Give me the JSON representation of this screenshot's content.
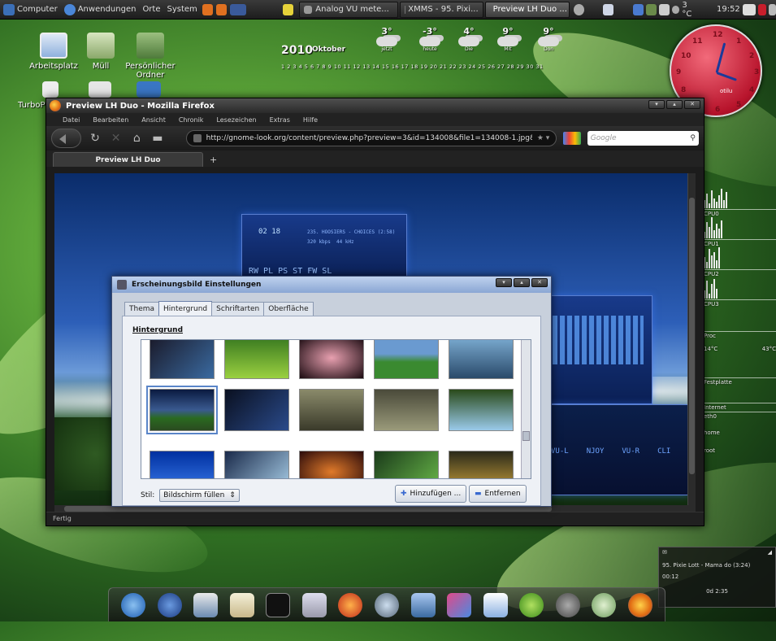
{
  "top_panel": {
    "menus": [
      "Computer",
      "Anwendungen",
      "Orte",
      "System"
    ],
    "tasks": [
      {
        "label": "Analog VU mete..."
      },
      {
        "label": "XMMS - 95. Pixi..."
      },
      {
        "label": "Preview LH Duo ..."
      }
    ],
    "weather_temp": "3 °C",
    "time": "19:52"
  },
  "desktop_icons": [
    "Arbeitsplatz",
    "Müll",
    "Persönlicher Ordner",
    "TurboP"
  ],
  "calendar": {
    "year": "2010",
    "month": "Oktober",
    "days": "1  2  3  4  5  6  7  8  9  10  11  12  13  14  15  16  17  18  19  20  21  22  23  24  25  26  27  28  29  30  31",
    "weather": [
      {
        "temp": "3°",
        "label": "jetzt"
      },
      {
        "temp": "-3°",
        "label": "heute"
      },
      {
        "temp": "4°",
        "label": "Die"
      },
      {
        "temp": "9°",
        "label": "Mit"
      },
      {
        "temp": "9°",
        "label": "Don"
      }
    ]
  },
  "clock": {
    "numbers": [
      "12",
      "1",
      "2",
      "3",
      "4",
      "5",
      "6",
      "7",
      "8",
      "9",
      "10",
      "11"
    ],
    "label": "otilu"
  },
  "firefox": {
    "title": "Preview LH Duo - Mozilla Firefox",
    "menu": [
      "Datei",
      "Bearbeiten",
      "Ansicht",
      "Chronik",
      "Lesezeichen",
      "Extras",
      "Hilfe"
    ],
    "url": "http://gnome-look.org/content/preview.php?preview=3&id=134008&file1=134008-1.jpg&f",
    "search_placeholder": "Google",
    "tab_label": "Preview LH Duo",
    "new_tab": "+",
    "status": "Fertig"
  },
  "media_player": {
    "time": "02 18",
    "track": "235. HOOSIERS - CHOICES (2:58)",
    "kbps": "320 kbps",
    "khz": "44 kHz",
    "buttons": "RW PL PS ST FW  SL",
    "vu_labels": [
      "VU-L",
      "NJOY",
      "VU-R",
      "CLI"
    ]
  },
  "dialog": {
    "title": "Erscheinungsbild Einstellungen",
    "tabs": [
      "Thema",
      "Hintergrund",
      "Schriftarten",
      "Oberfläche"
    ],
    "section": "Hintergrund",
    "style_label": "Stil:",
    "style_value": "Bildschirm füllen",
    "add_button": "Hinzufügen ...",
    "remove_button": "Entfernen"
  },
  "conky": {
    "labels": [
      "CPU0",
      "CPU1",
      "CPU2",
      "CPU3",
      "Proc",
      "Festplatte",
      "Internet",
      "eth0",
      "home",
      "root"
    ],
    "notes": [
      "14°C",
      "43°C"
    ]
  },
  "xmms_mini": {
    "track": "95. Pixie Lott - Mama do (3:24)",
    "elapsed": "00:12",
    "total": "0d 2:35"
  },
  "colors": {
    "accent": "#4a7ad0",
    "clock_red": "#c8182e"
  }
}
